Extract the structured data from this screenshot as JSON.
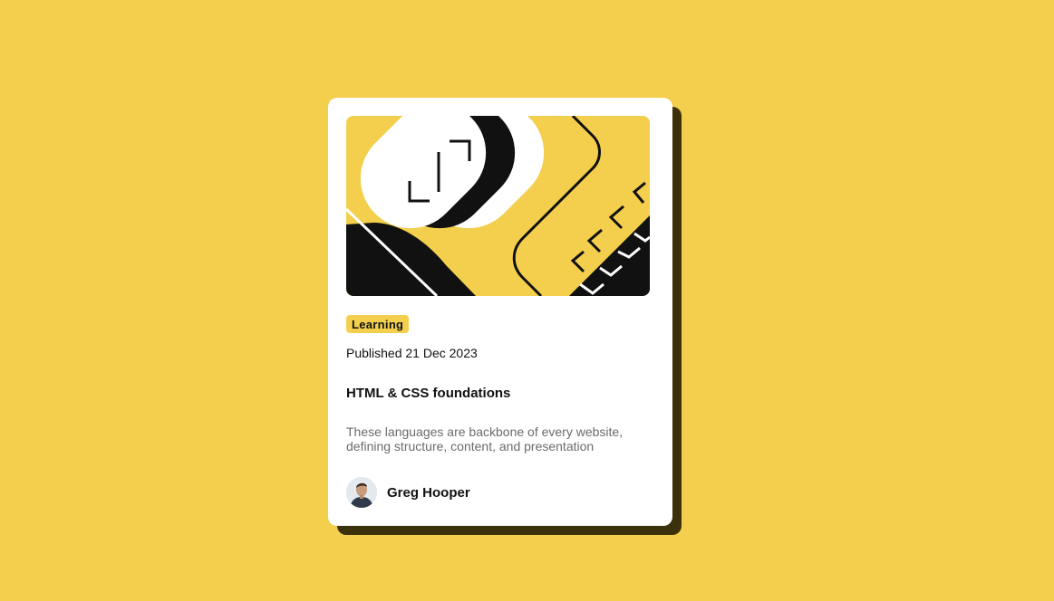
{
  "colors": {
    "background": "#f4cf4d",
    "card": "#ffffff",
    "shadow": "#3b310b",
    "text": "#111111",
    "muted": "#6b6b6b"
  },
  "card": {
    "illustration_icon": "abstract-illustration",
    "tag": "Learning",
    "published": "Published 21 Dec 2023",
    "title": "HTML & CSS foundations",
    "description": "These languages are backbone of every website, defining structure, content, and presentation",
    "author": {
      "name": "Greg Hooper",
      "avatar_icon": "avatar-photo"
    }
  }
}
